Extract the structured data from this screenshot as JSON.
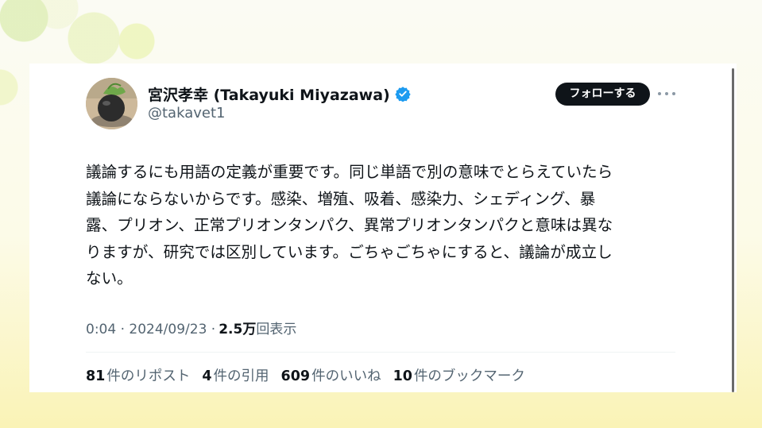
{
  "author": {
    "display_name": "宮沢孝幸 (Takayuki Miyazawa)",
    "handle": "@takavet1",
    "verified": true,
    "verified_color": "#1d9bf0"
  },
  "actions": {
    "follow_label": "フォローする",
    "more_icon": "more-horizontal-icon"
  },
  "tweet": {
    "lines": [
      "議論するにも用語の定義が重要です。同じ単語で別の意味でとらえていたら",
      "議論にならないからです。感染、増殖、吸着、感染力、シェディング、暴",
      "露、プリオン、正常プリオンタンパク、異常プリオンタンパクと意味は異な",
      "りますが、研究では区別しています。ごちゃごちゃにすると、議論が成立し",
      "ない。"
    ]
  },
  "meta": {
    "time": "0:04",
    "date": "2024/09/23",
    "views_count": "2.5万",
    "views_label": "回表示"
  },
  "stats": [
    {
      "count": "81",
      "label": "件のリポスト"
    },
    {
      "count": "4",
      "label": "件の引用"
    },
    {
      "count": "609",
      "label": "件のいいね"
    },
    {
      "count": "10",
      "label": "件のブックマーク"
    }
  ]
}
